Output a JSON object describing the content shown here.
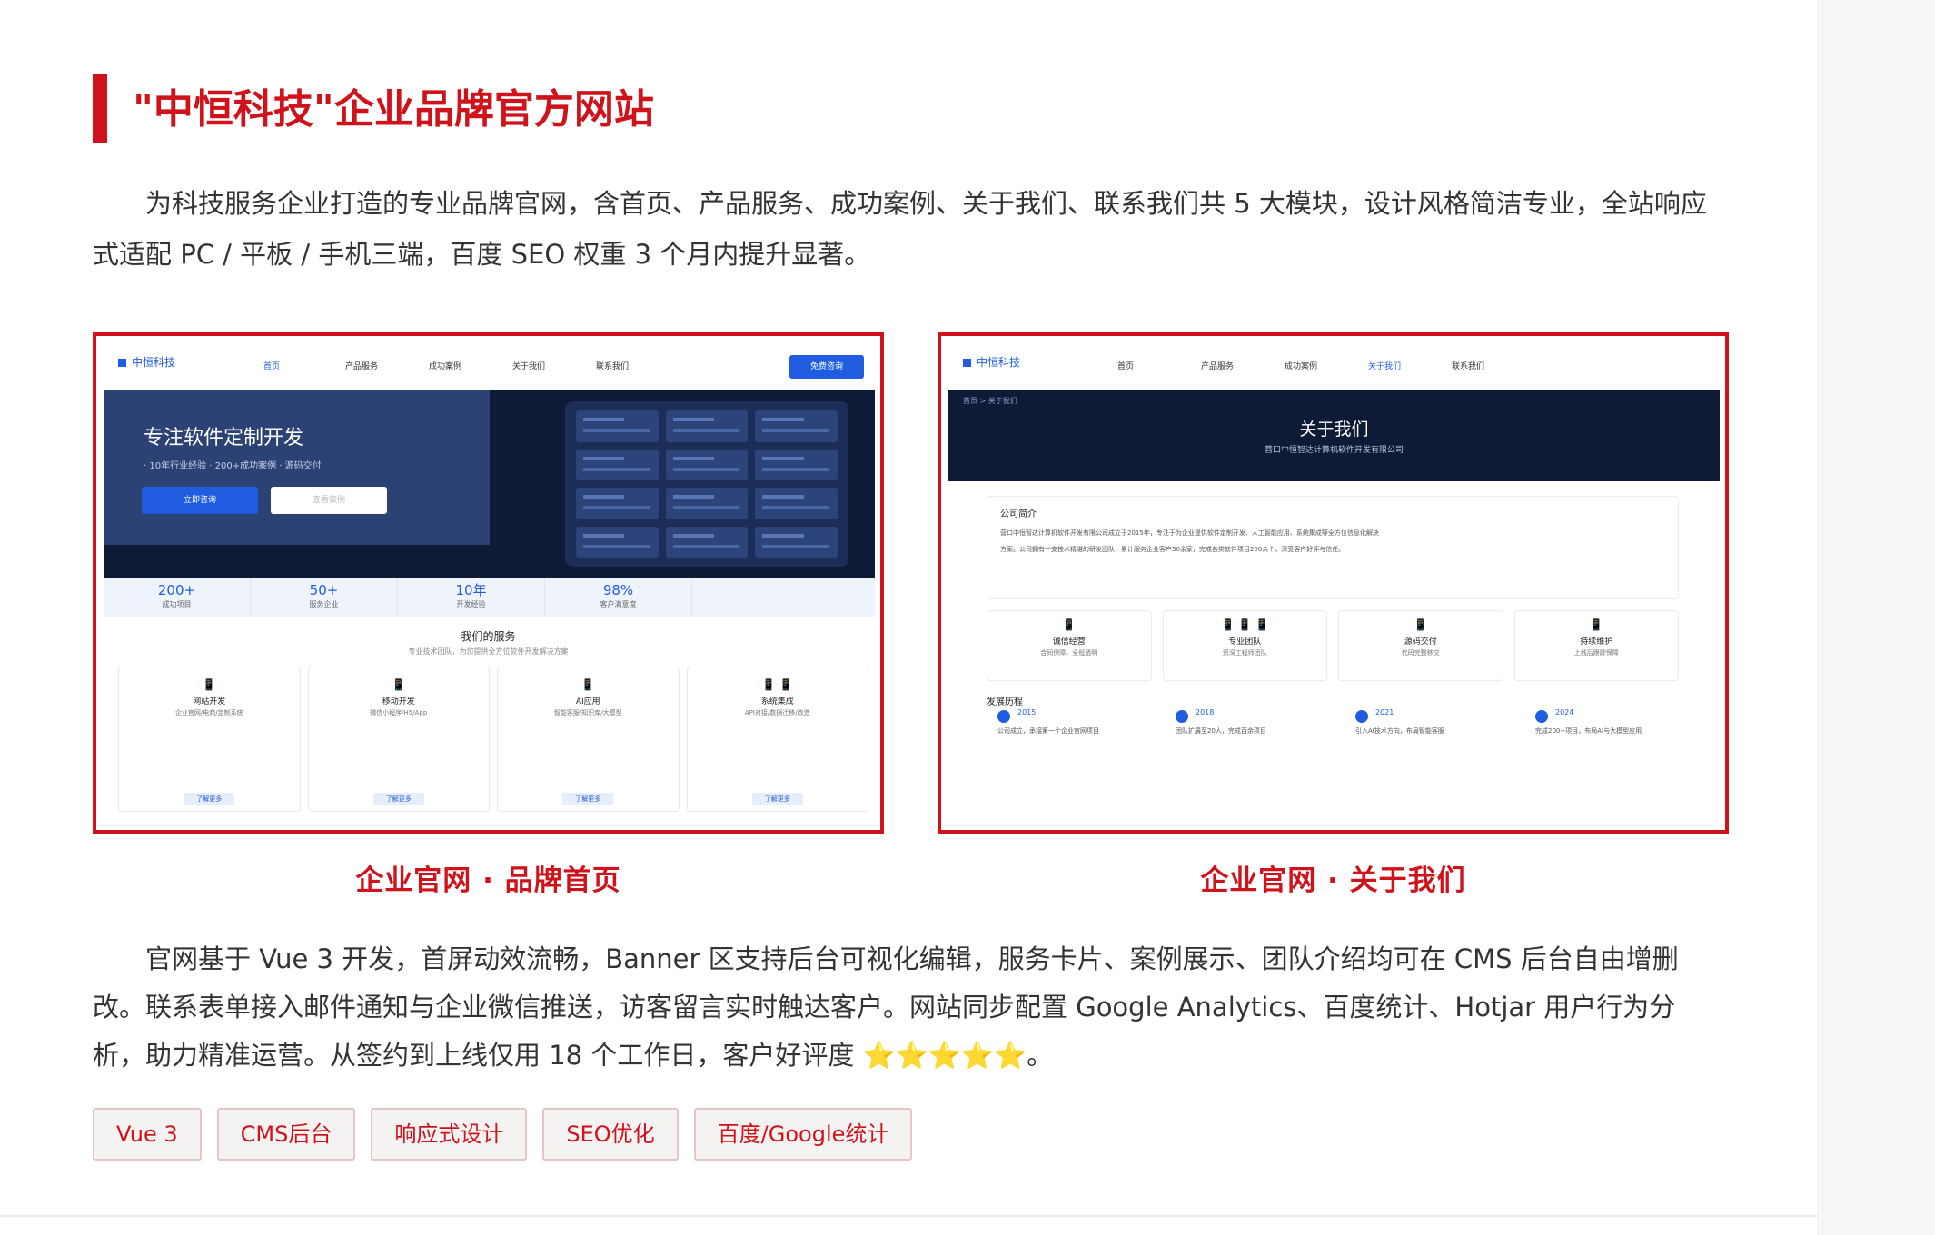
{
  "title": "\"中恒科技\"企业品牌官方网站",
  "intro": "为科技服务企业打造的专业品牌官网，含首页、产品服务、成功案例、关于我们、联系我们共 5 大模块，设计风格简洁专业，全站响应式适配 PC / 平板 / 手机三端，百度 SEO 权重 3 个月内提升显著。",
  "accent_color": "#d0121b",
  "screenshots": {
    "home": {
      "caption": "企业官网 · 品牌首页",
      "logo": "中恒科技",
      "nav": [
        "首页",
        "产品服务",
        "成功案例",
        "关于我们",
        "联系我们"
      ],
      "cta": "免费咨询",
      "hero_title": "专注软件定制开发",
      "hero_sub": "·  10年行业经验  ·  200+成功案例  ·  源码交付",
      "hero_btn_primary": "立即咨询",
      "hero_btn_secondary": "查看案例",
      "stats": [
        {
          "value": "200+",
          "label": "成功项目"
        },
        {
          "value": "50+",
          "label": "服务企业"
        },
        {
          "value": "10年",
          "label": "开发经验"
        },
        {
          "value": "98%",
          "label": "客户满意度"
        }
      ],
      "services_title": "我们的服务",
      "services_sub": "专业技术团队，为您提供全方位软件开发解决方案",
      "services": [
        {
          "icon": "📱",
          "title": "网站开发",
          "desc": "企业官网/电商/定制系统",
          "btn": "了解更多"
        },
        {
          "icon": "📱",
          "title": "移动开发",
          "desc": "微信小程序/H5/App",
          "btn": "了解更多"
        },
        {
          "icon": "📱",
          "title": "AI应用",
          "desc": "智能客服/知识库/大模型",
          "btn": "了解更多"
        },
        {
          "icon": "📱 📱",
          "title": "系统集成",
          "desc": "API对接/数据迁移/改造",
          "btn": "了解更多"
        }
      ]
    },
    "about": {
      "caption": "企业官网 · 关于我们",
      "logo": "中恒科技",
      "nav": [
        "首页",
        "产品服务",
        "成功案例",
        "关于我们",
        "联系我们"
      ],
      "breadcrumb": "首页 > 关于我们",
      "banner_title": "关于我们",
      "banner_sub": "营口中恒智达计算机软件开发有限公司",
      "intro_title": "公司简介",
      "intro_text": "营口中恒智达计算机软件开发有限公司成立于2015年，专注于为企业提供软件定制开发、人工智能应用、系统集成等全方位信息化解决方案。公司拥有一支技术精湛的研发团队，累计服务企业客户50余家，完成各类软件项目200余个，深受客户好评与信任。",
      "features": [
        {
          "icon": "📱",
          "title": "诚信经营",
          "desc": "合同保障，全程透明"
        },
        {
          "icon": "📱 📱 📱",
          "title": "专业团队",
          "desc": "资深工程师团队"
        },
        {
          "icon": "📱",
          "title": "源码交付",
          "desc": "代码完整移交"
        },
        {
          "icon": "📱",
          "title": "持续维护",
          "desc": "上线后跟踪保障"
        }
      ],
      "history_title": "发展历程",
      "history": [
        {
          "year": "2015",
          "event": "公司成立，承接第一个企业官网项目"
        },
        {
          "year": "2018",
          "event": "团队扩展至20人，完成百余项目"
        },
        {
          "year": "2021",
          "event": "引入AI技术方向，布局智能客服"
        },
        {
          "year": "2024",
          "event": "完成200+项目，布局AI与大模型应用"
        }
      ]
    }
  },
  "details": "官网基于 Vue 3 开发，首屏动效流畅，Banner 区支持后台可视化编辑，服务卡片、案例展示、团队介绍均可在 CMS 后台自由增删改。联系表单接入邮件通知与企业微信推送，访客留言实时触达客户。网站同步配置 Google Analytics、百度统计、Hotjar 用户行为分析，助力精准运营。从签约到上线仅用 18 个工作日，客户好评度 ⭐⭐⭐⭐⭐。",
  "tags": [
    "Vue 3",
    "CMS后台",
    "响应式设计",
    "SEO优化",
    "百度/Google统计"
  ]
}
